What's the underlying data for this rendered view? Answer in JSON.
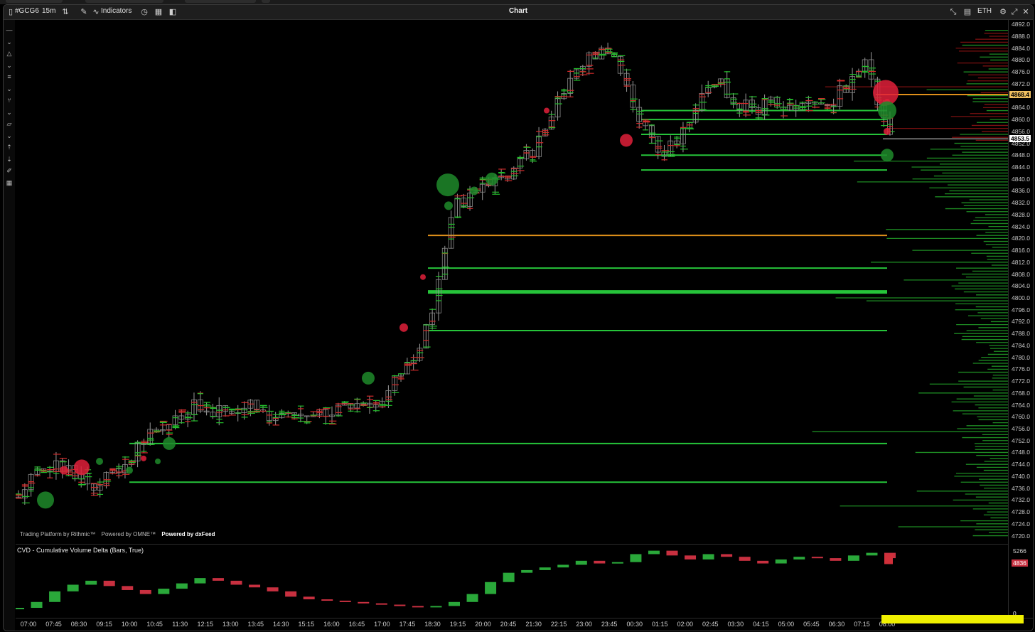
{
  "header": {
    "symbol": "#GCG6",
    "interval": "15m",
    "indicators_label": "Indicators",
    "title": "Chart",
    "session": "ETH"
  },
  "left_tools": [
    "minus-icon",
    "chevron-icon",
    "triangle-icon",
    "chevron-icon",
    "bars-icon",
    "chevron-icon",
    "fork-icon",
    "chevron-icon",
    "ruler-icon",
    "chevron-icon",
    "arrow-up-icon",
    "arrow-down-icon",
    "pencil-eraser-icon",
    "grid-icon"
  ],
  "price_axis": {
    "ticks": [
      "4892.0",
      "4888.0",
      "4884.0",
      "4880.0",
      "4876.0",
      "4872.0",
      "4868.0",
      "4864.0",
      "4860.0",
      "4856.0",
      "4852.0",
      "4848.0",
      "4844.0",
      "4840.0",
      "4836.0",
      "4832.0",
      "4828.0",
      "4824.0",
      "4820.0",
      "4816.0",
      "4812.0",
      "4808.0",
      "4804.0",
      "4800.0",
      "4796.0",
      "4792.0",
      "4788.0",
      "4784.0",
      "4780.0",
      "4776.0",
      "4772.0",
      "4768.0",
      "4764.0",
      "4760.0",
      "4756.0",
      "4752.0",
      "4748.0",
      "4744.0",
      "4740.0",
      "4736.0",
      "4732.0",
      "4728.0",
      "4724.0",
      "4720.0"
    ],
    "highlight_price": "4868.4",
    "last_price": "4853.5"
  },
  "cvd": {
    "label": "CVD - Cumulative Volume Delta (Bars, True)",
    "axis_top": "5266",
    "last_value": "4836",
    "bottom_marker": "0"
  },
  "time_axis": [
    "07:00",
    "07:45",
    "08:30",
    "09:15",
    "10:00",
    "10:45",
    "11:30",
    "12:15",
    "13:00",
    "13:45",
    "14:30",
    "15:15",
    "16:00",
    "16:45",
    "17:00",
    "17:45",
    "18:30",
    "19:15",
    "20:00",
    "20:45",
    "21:30",
    "22:15",
    "23:00",
    "23:45",
    "00:30",
    "01:15",
    "02:00",
    "02:45",
    "03:30",
    "04:15",
    "05:00",
    "05:45",
    "06:30",
    "07:15",
    "08:00"
  ],
  "credits": {
    "rithmic": "Trading Platform by Rithmic™",
    "omne": "Powered by OMNE™",
    "dxfeed": "Powered by dxFeed"
  },
  "colors": {
    "up": "#22c02a",
    "down": "#d42a2a",
    "level_orange": "#e0901a",
    "level_green": "#26c43a",
    "volume_bubble_red": "#e0203a",
    "volume_bubble_green": "#1f8a2a",
    "yellow_marker": "#f0f000"
  },
  "chart_data": {
    "type": "candlestick",
    "symbol": "#GCG6",
    "interval": "15m",
    "ylim": [
      4718,
      4893
    ],
    "x": [
      "07:00",
      "07:45",
      "08:30",
      "09:15",
      "10:00",
      "10:45",
      "11:30",
      "12:15",
      "13:00",
      "13:45",
      "14:30",
      "15:15",
      "16:00",
      "16:45",
      "17:00",
      "17:45",
      "18:30",
      "19:15",
      "20:00",
      "20:45",
      "21:30",
      "22:15",
      "23:00",
      "23:45",
      "00:30",
      "01:15",
      "02:00",
      "02:45",
      "03:30",
      "04:15",
      "05:00",
      "05:45",
      "06:30",
      "07:15",
      "08:00"
    ],
    "close_path": [
      4733,
      4745,
      4742,
      4738,
      4744,
      4752,
      4760,
      4764,
      4762,
      4766,
      4758,
      4760,
      4762,
      4766,
      4764,
      4775,
      4790,
      4830,
      4836,
      4842,
      4848,
      4866,
      4878,
      4884,
      4866,
      4848,
      4856,
      4874,
      4866,
      4864,
      4866,
      4865,
      4868,
      4878,
      4853.5
    ],
    "horizontal_levels": [
      {
        "price": 4868.4,
        "color": "orange"
      },
      {
        "price": 4821.0,
        "color": "orange"
      },
      {
        "price": 4863.0,
        "color": "green"
      },
      {
        "price": 4860.0,
        "color": "green"
      },
      {
        "price": 4855.0,
        "color": "green"
      },
      {
        "price": 4848.0,
        "color": "green"
      },
      {
        "price": 4843.0,
        "color": "green"
      },
      {
        "price": 4810.0,
        "color": "green"
      },
      {
        "price": 4802.0,
        "color": "green"
      },
      {
        "price": 4789.0,
        "color": "green"
      },
      {
        "price": 4751.0,
        "color": "green"
      },
      {
        "price": 4738.0,
        "color": "green"
      }
    ],
    "cvd_values": [
      4836,
      4880,
      4960,
      5010,
      5040,
      5000,
      4970,
      4940,
      4980,
      5020,
      5060,
      5040,
      5010,
      4990,
      4960,
      4920,
      4900,
      4890,
      4880,
      4870,
      4860,
      4850,
      4840,
      4850,
      4880,
      4940,
      5030,
      5100,
      5120,
      5140,
      5160,
      5190,
      5170,
      5180,
      5240,
      5266,
      5230,
      5200,
      5240,
      5220,
      5190,
      5170,
      5200,
      5220,
      5210,
      5190,
      5230,
      5250,
      5210
    ]
  }
}
